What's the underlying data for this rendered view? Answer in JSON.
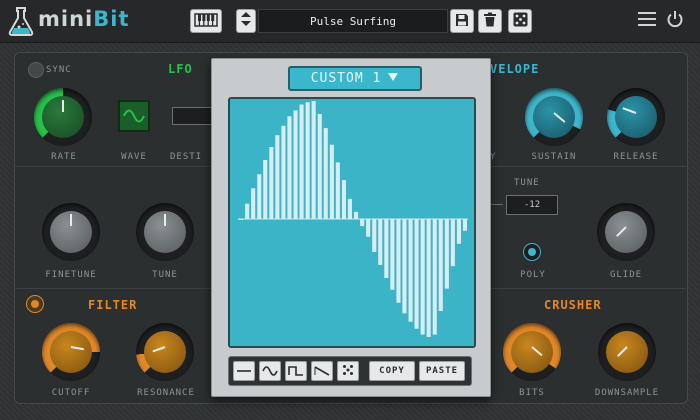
{
  "app": {
    "brand_a": "mini",
    "brand_b": "Bit"
  },
  "preset": {
    "name": "Pulse Surfing"
  },
  "icons": {
    "flask": "flask-icon",
    "keyboard": "keyboard-icon",
    "save": "save-icon",
    "trash": "trash-icon",
    "dice": "dice-icon",
    "menu": "menu-icon",
    "power": "power-icon"
  },
  "lfo": {
    "title": "LFO",
    "sync": "SYNC",
    "rate": "RATE",
    "wave": "WAVE",
    "dest": "DESTI"
  },
  "envelope": {
    "title": "VELOPE",
    "decay_tail": "Y",
    "sustain": "SUSTAIN",
    "release": "RELEASE"
  },
  "voice": {
    "finetune": "FINETUNE",
    "tune": "TUNE",
    "tune_box_label": "TUNE",
    "tune_value": "-12",
    "poly": "POLY",
    "glide": "GLIDE"
  },
  "filter": {
    "title": "FILTER",
    "cutoff": "CUTOFF",
    "resonance": "RESONANCE"
  },
  "crusher": {
    "title": "CRUSHER",
    "bits": "BITS",
    "downsample": "DOWNSAMPLE"
  },
  "wave_editor": {
    "selector": "CUSTOM 1",
    "copy": "COPY",
    "paste": "PASTE",
    "tools": [
      "flat-wave-icon",
      "sine-wave-icon",
      "square-wave-icon",
      "saw-wave-icon",
      "random-dice-icon"
    ],
    "samples": [
      0.0,
      0.13,
      0.26,
      0.38,
      0.5,
      0.61,
      0.71,
      0.79,
      0.87,
      0.92,
      0.97,
      0.99,
      1.0,
      0.89,
      0.77,
      0.63,
      0.48,
      0.33,
      0.17,
      0.06,
      -0.06,
      -0.15,
      -0.28,
      -0.39,
      -0.5,
      -0.6,
      -0.71,
      -0.8,
      -0.87,
      -0.93,
      -0.98,
      -1.0,
      -0.98,
      -0.78,
      -0.59,
      -0.4,
      -0.21,
      -0.1
    ],
    "colors": {
      "screen": "#3ab4c6",
      "bars": "#d7ecf3"
    }
  },
  "colors": {
    "accent_cyan": "#3fb5cc",
    "accent_green": "#27c04a",
    "accent_orange": "#e0872a"
  }
}
